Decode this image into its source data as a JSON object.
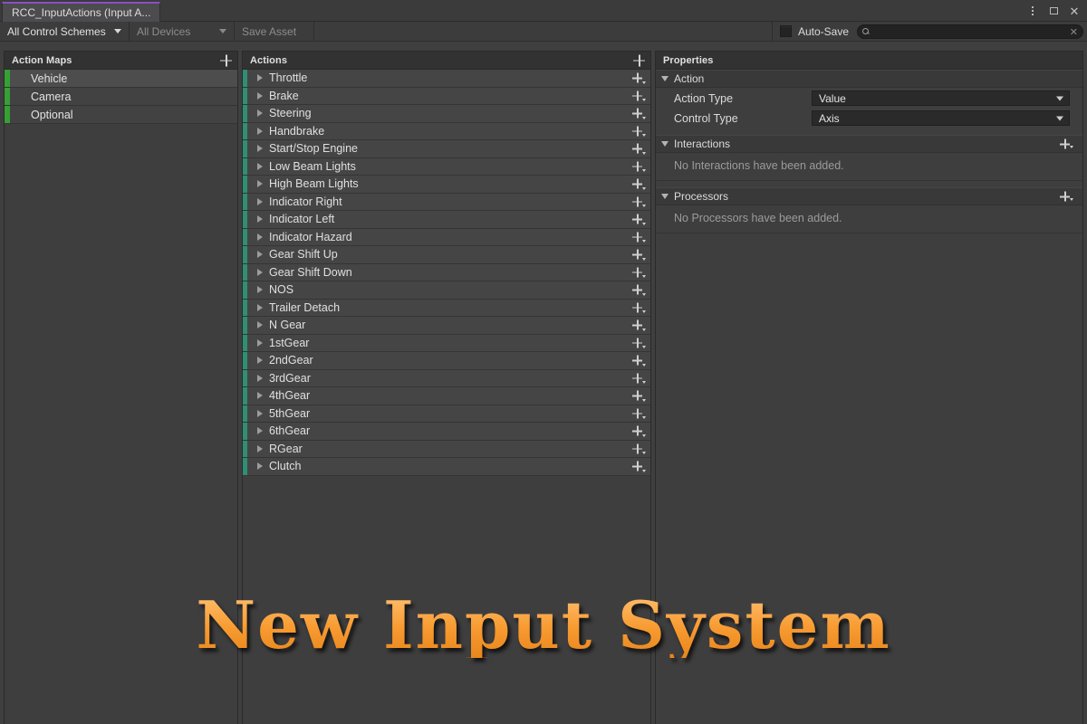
{
  "window": {
    "tab_title": "RCC_InputActions (Input A...",
    "controls": {
      "menu_icon": "vertical-dots-icon",
      "maximize_icon": "maximize-icon",
      "close_icon": "close-icon"
    }
  },
  "toolbar": {
    "control_schemes": "All Control Schemes",
    "devices": "All Devices",
    "save_asset": "Save Asset",
    "auto_save_label": "Auto-Save",
    "auto_save_checked": false,
    "search_value": "",
    "search_placeholder": "",
    "search_icon": "search-icon",
    "clear_icon": "close-icon"
  },
  "action_maps": {
    "header": "Action Maps",
    "add_label": "+",
    "accent_color": "#35a135",
    "selected": "Vehicle",
    "items": [
      {
        "label": "Vehicle"
      },
      {
        "label": "Camera"
      },
      {
        "label": "Optional"
      }
    ]
  },
  "actions": {
    "header": "Actions",
    "add_label": "+",
    "accent_color": "#2f8f74",
    "items": [
      {
        "label": "Throttle"
      },
      {
        "label": "Brake"
      },
      {
        "label": "Steering"
      },
      {
        "label": "Handbrake"
      },
      {
        "label": "Start/Stop Engine"
      },
      {
        "label": "Low Beam Lights"
      },
      {
        "label": "High Beam Lights"
      },
      {
        "label": "Indicator Right"
      },
      {
        "label": "Indicator Left"
      },
      {
        "label": "Indicator Hazard"
      },
      {
        "label": "Gear Shift Up"
      },
      {
        "label": "Gear Shift Down"
      },
      {
        "label": "NOS"
      },
      {
        "label": "Trailer Detach"
      },
      {
        "label": "N Gear"
      },
      {
        "label": "1stGear"
      },
      {
        "label": "2ndGear"
      },
      {
        "label": "3rdGear"
      },
      {
        "label": "4thGear"
      },
      {
        "label": "5thGear"
      },
      {
        "label": "6thGear"
      },
      {
        "label": "RGear"
      },
      {
        "label": "Clutch"
      }
    ]
  },
  "properties": {
    "header": "Properties",
    "action_section": {
      "title": "Action",
      "expanded": true,
      "rows": [
        {
          "label": "Action Type",
          "value": "Value"
        },
        {
          "label": "Control Type",
          "value": "Axis"
        }
      ]
    },
    "interactions_section": {
      "title": "Interactions",
      "expanded": true,
      "empty_text": "No Interactions have been added.",
      "add_label": "+"
    },
    "processors_section": {
      "title": "Processors",
      "expanded": true,
      "empty_text": "No Processors have been added.",
      "add_label": "+"
    }
  },
  "overlay": {
    "title": "New Input System",
    "color_light": "#ffc070",
    "color_dark": "#e8861c"
  }
}
